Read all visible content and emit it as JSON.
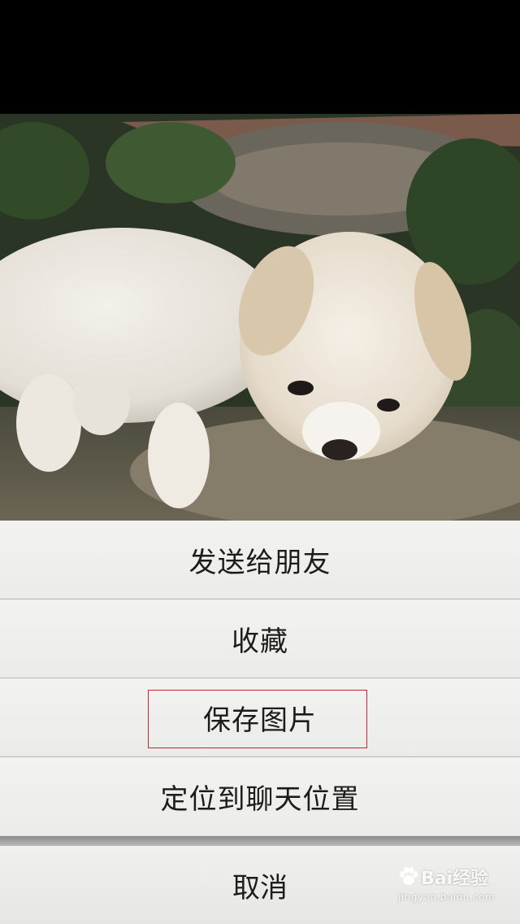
{
  "action_sheet": {
    "items": [
      {
        "label": "发送给朋友"
      },
      {
        "label": "收藏"
      },
      {
        "label": "保存图片"
      },
      {
        "label": "定位到聊天位置"
      }
    ],
    "cancel_label": "取消"
  },
  "photo": {
    "subject": "puppy-photo"
  },
  "watermark": {
    "brand": "Bai经验",
    "domain": "jingyan.baidu.com"
  },
  "colors": {
    "highlight_border": "#c8282c",
    "sheet_background": "#efefee",
    "text": "#1c1c1c"
  }
}
